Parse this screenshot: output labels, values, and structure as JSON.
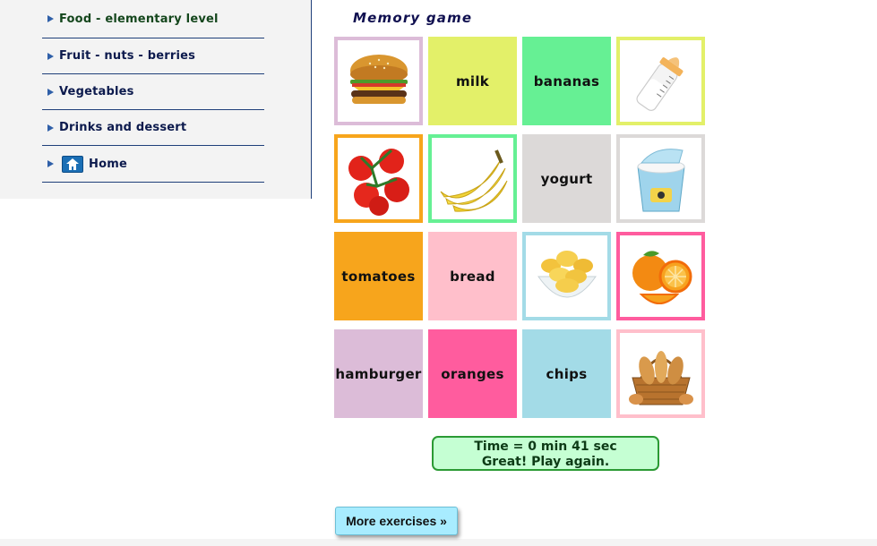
{
  "sidebar": {
    "items": [
      {
        "label": "Food - elementary level"
      },
      {
        "label": "Fruit - nuts - berries"
      },
      {
        "label": "Vegetables"
      },
      {
        "label": "Drinks and dessert"
      },
      {
        "label": "Home",
        "icon": "home-icon"
      }
    ]
  },
  "game": {
    "title": "Memory game",
    "cards": [
      {
        "type": "picture",
        "icon": "hamburger-image",
        "border": "#dcbcd8"
      },
      {
        "type": "word",
        "label": "milk",
        "color": "#e3f069"
      },
      {
        "type": "word",
        "label": "bananas",
        "color": "#66f094"
      },
      {
        "type": "picture",
        "icon": "milk-bottle-image",
        "border": "#e3f069"
      },
      {
        "type": "picture",
        "icon": "tomatoes-image",
        "border": "#f7a51c"
      },
      {
        "type": "picture",
        "icon": "bananas-image",
        "border": "#66f094"
      },
      {
        "type": "word",
        "label": "yogurt",
        "color": "#dcd9d8"
      },
      {
        "type": "picture",
        "icon": "yogurt-image",
        "border": "#dcd9d8"
      },
      {
        "type": "word",
        "label": "tomatoes",
        "color": "#f7a51c"
      },
      {
        "type": "word",
        "label": "bread",
        "color": "#ffbfcb"
      },
      {
        "type": "picture",
        "icon": "chips-image",
        "border": "#a3dbe7"
      },
      {
        "type": "picture",
        "icon": "oranges-image",
        "border": "#ff5c9e"
      },
      {
        "type": "word",
        "label": "hamburger",
        "color": "#dcbcd8"
      },
      {
        "type": "word",
        "label": "oranges",
        "color": "#ff5c9e"
      },
      {
        "type": "word",
        "label": "chips",
        "color": "#a3dbe7"
      },
      {
        "type": "picture",
        "icon": "bread-image",
        "border": "#ffbfcb"
      }
    ],
    "result": {
      "time": "Time = 0 min 41 sec",
      "message": "Great! Play again."
    }
  },
  "more_button": {
    "label": "More exercises »"
  }
}
